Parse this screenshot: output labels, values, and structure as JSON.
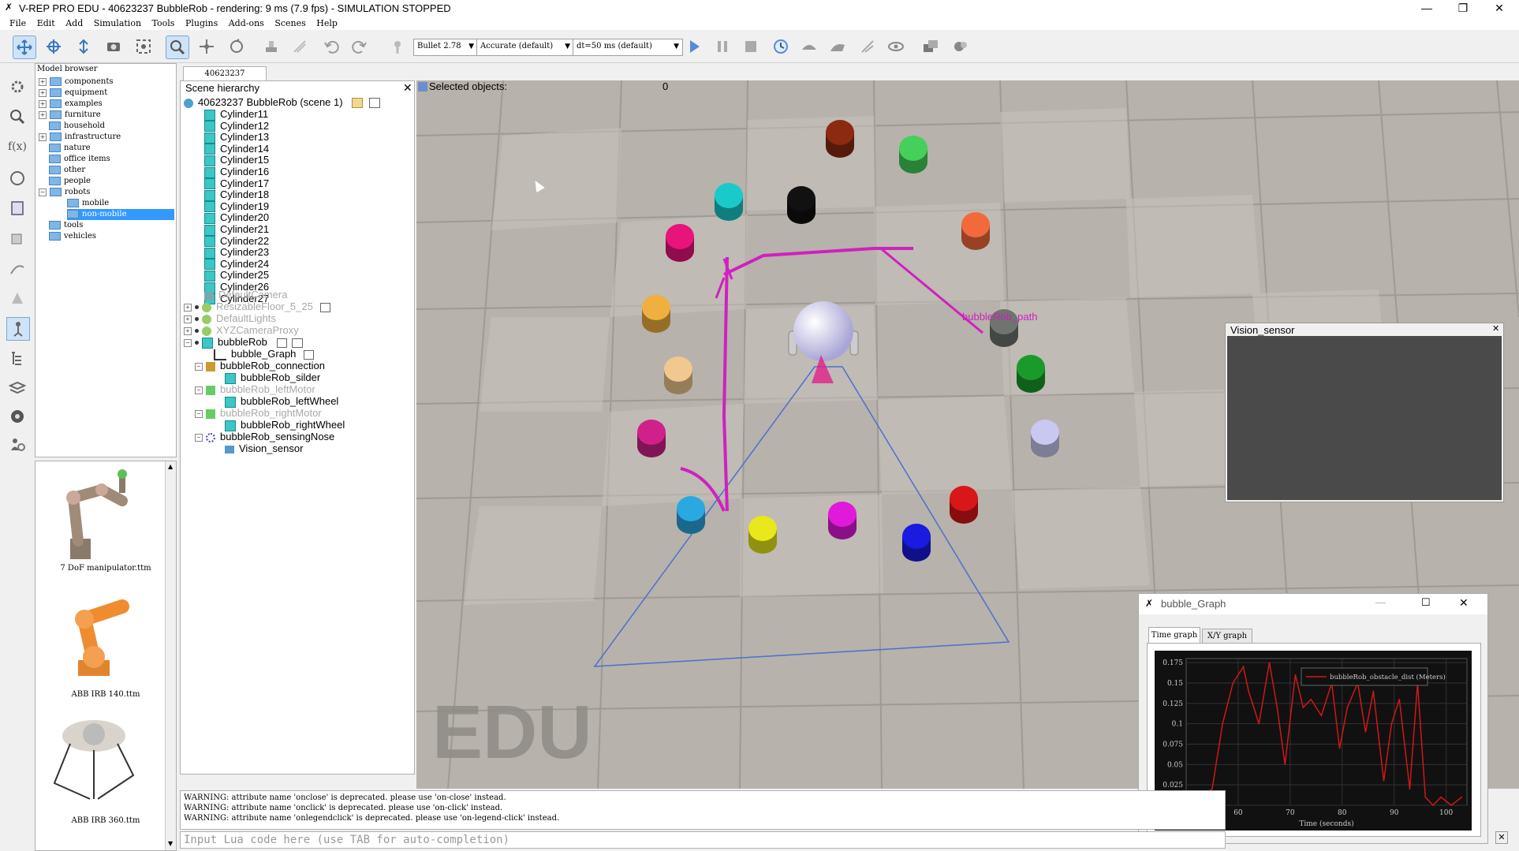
{
  "window": {
    "title": "V-REP PRO EDU - 40623237 BubbleRob - rendering: 9 ms (7.9 fps) - SIMULATION STOPPED"
  },
  "menu": [
    "File",
    "Edit",
    "Add",
    "Simulation",
    "Tools",
    "Plugins",
    "Add-ons",
    "Scenes",
    "Help"
  ],
  "toolbar": {
    "engine": "Bullet 2.78",
    "accuracy": "Accurate (default)",
    "timestep": "dt=50 ms (default)"
  },
  "model_browser": {
    "title": "Model browser",
    "items": [
      "components",
      "equipment",
      "examples",
      "furniture",
      "household",
      "infrastructure",
      "nature",
      "office items",
      "other",
      "people",
      "robots",
      "mobile",
      "non-mobile",
      "tools",
      "vehicles"
    ],
    "selected": "non-mobile",
    "thumbnails": [
      "7 DoF manipulator.ttm",
      "ABB IRB 140.ttm",
      "ABB IRB 360.ttm"
    ]
  },
  "scene_tab": "40623237 BubbleRob",
  "hierarchy": {
    "title": "Scene hierarchy",
    "root": "40623237 BubbleRob (scene 1)",
    "cylinders": [
      "Cylinder11",
      "Cylinder12",
      "Cylinder13",
      "Cylinder14",
      "Cylinder15",
      "Cylinder16",
      "Cylinder17",
      "Cylinder18",
      "Cylinder19",
      "Cylinder20",
      "Cylinder21",
      "Cylinder22",
      "Cylinder23",
      "Cylinder24",
      "Cylinder25",
      "Cylinder26",
      "Cylinder27"
    ],
    "default_camera": "DefaultCamera",
    "floor": "ResizableFloor_5_25",
    "lights": "DefaultLights",
    "camera_proxy": "XYZCameraProxy",
    "bubble_rob": "bubbleRob",
    "graph": "bubble_Graph",
    "connection": "bubbleRob_connection",
    "slider": "bubbleRob_silder",
    "left_motor": "bubbleRob_leftMotor",
    "left_wheel": "bubbleRob_leftWheel",
    "right_motor": "bubbleRob_rightMotor",
    "right_wheel": "bubbleRob_rightWheel",
    "sensing_nose": "bubbleRob_sensingNose",
    "vision_sensor": "Vision_sensor"
  },
  "viewport": {
    "selected_label": "Selected objects:",
    "selected_count": "0",
    "path_label": "bubbleRob_path",
    "watermark": "EDU"
  },
  "vision_window": {
    "title": "Vision_sensor"
  },
  "graph_window": {
    "title": "bubble_Graph",
    "tabs": [
      "Time graph",
      "X/Y graph"
    ],
    "legend": "bubbleRob_obstacle_dist (Meters)",
    "xlabel": "Time (seconds)",
    "y_ticks": [
      "0.175",
      "0.15",
      "0.125",
      "0.1",
      "0.075",
      "0.05",
      "0.025",
      "0"
    ],
    "x_ticks": [
      "60",
      "70",
      "80",
      "90",
      "100"
    ]
  },
  "chart_data": {
    "type": "line",
    "title": "",
    "xlabel": "Time (seconds)",
    "ylabel": "",
    "xlim": [
      50,
      104
    ],
    "ylim": [
      0,
      0.18
    ],
    "series": [
      {
        "name": "bubbleRob_obstacle_dist (Meters)",
        "color": "#d01818",
        "x": [
          50,
          53,
          55,
          57,
          59,
          61,
          62,
          64,
          66,
          67.5,
          69,
          71,
          72.5,
          74,
          76,
          78,
          79.5,
          81,
          83,
          84.5,
          86,
          88,
          89.5,
          91,
          93,
          94.5,
          96,
          97.5,
          99,
          101,
          103
        ],
        "y": [
          0.01,
          0.012,
          0.02,
          0.1,
          0.15,
          0.17,
          0.14,
          0.1,
          0.175,
          0.12,
          0.05,
          0.16,
          0.12,
          0.13,
          0.11,
          0.15,
          0.07,
          0.12,
          0.15,
          0.09,
          0.14,
          0.03,
          0.1,
          0.13,
          0.02,
          0.15,
          0.01,
          0.0,
          0.01,
          0.0,
          0.01
        ]
      }
    ]
  },
  "console": {
    "lines": [
      "WARNING: attribute name 'onclose' is deprecated. please use 'on-close' instead.",
      "WARNING: attribute name 'onclick' is deprecated. please use 'on-click' instead.",
      "WARNING: attribute name 'onlegendclick' is deprecated. please use 'on-legend-click' instead."
    ],
    "input_placeholder": "Input Lua code here (use TAB for auto-completion)"
  },
  "colors": {
    "cylinders": [
      "#8b2a10",
      "#44d05a",
      "#f26a3c",
      "#6e746e",
      "#1a9a2a",
      "#c8c8f0",
      "#d81818",
      "#1a1ae0",
      "#e01ad8",
      "#e8e81a",
      "#2aa8e0",
      "#d0208a",
      "#f0c890",
      "#f0b040",
      "#e8147a",
      "#1acaca",
      "#111111"
    ],
    "path": "#d020c0",
    "sensor": "#4a70d0"
  }
}
